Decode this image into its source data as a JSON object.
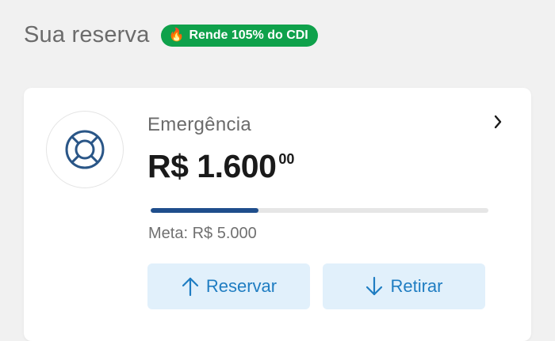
{
  "header": {
    "title": "Sua reserva",
    "badge_icon": "🔥",
    "badge_label": "Rende 105% do CDI"
  },
  "card": {
    "icon": "lifebuoy-icon",
    "title": "Emergência",
    "amount_main": "R$ 1.600",
    "amount_cents": "00",
    "progress": 0.32,
    "goal_label": "Meta: R$ 5.000",
    "buttons": {
      "reserve_label": "Reservar",
      "withdraw_label": "Retirar"
    }
  },
  "colors": {
    "badge": "#0fa14b",
    "progress_fill": "#1f4e8c",
    "button_bg": "#e1f0fb",
    "button_text": "#1f7dc2"
  }
}
